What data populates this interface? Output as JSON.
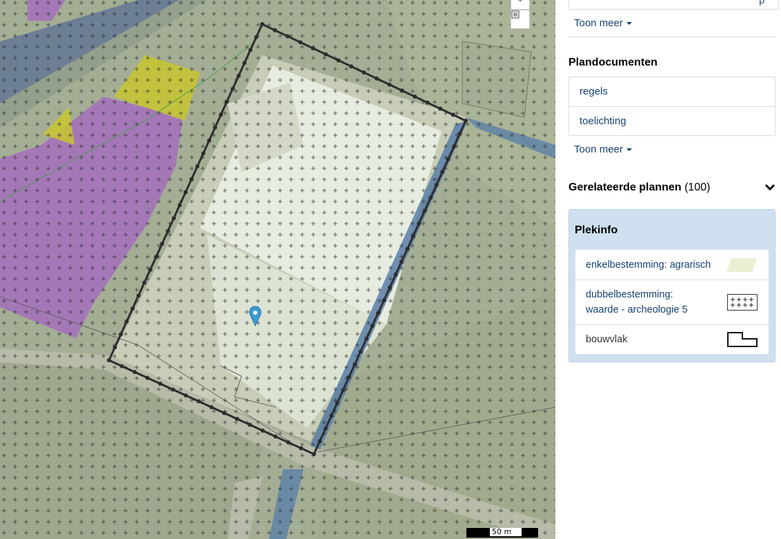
{
  "map": {
    "scale_label": "50 m",
    "buttons": {
      "zoom_icon": "plus-icon",
      "list_icon": "list-icon"
    },
    "colors": {
      "parcel_outline": "#3a3a3a",
      "purple_zone": "#a469c0",
      "yellow_zone": "#c9c530",
      "infra_blue": "#5b7fa8"
    }
  },
  "sidebar": {
    "top_link_fragment": "p",
    "toon_meer_1": "Toon meer",
    "plandocumenten_title": "Plandocumenten",
    "documents": [
      "regels",
      "toelichting"
    ],
    "toon_meer_2": "Toon meer",
    "related_title": "Gerelateerde plannen",
    "related_count": "(100)",
    "plekinfo": {
      "title": "Plekinfo",
      "items": [
        {
          "label": "enkelbestemming: agrarisch",
          "legend": "agrarisch-legend-icon"
        },
        {
          "label_line1": "dubbelbestemming:",
          "label_line2": "waarde - archeologie 5",
          "legend": "archeologie-legend-icon"
        },
        {
          "label": "bouwvlak",
          "legend": "bouwvlak-legend-icon"
        }
      ]
    }
  }
}
